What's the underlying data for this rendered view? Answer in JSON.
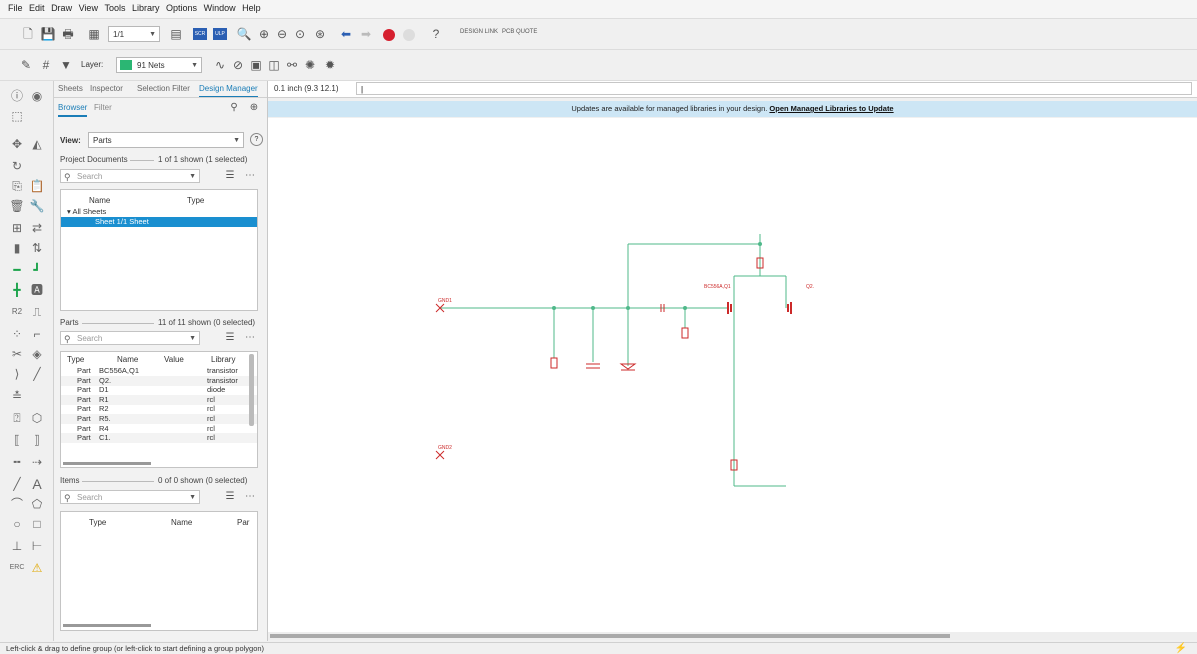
{
  "menu": [
    "File",
    "Edit",
    "Draw",
    "View",
    "Tools",
    "Library",
    "Options",
    "Window",
    "Help"
  ],
  "toolbar": {
    "page_value": "1/1",
    "layer_label": "Layer:",
    "layer_value": "91 Nets",
    "layer_color": "#2bb673",
    "design_link_label": "DESIGN LINK",
    "pcb_quote_label": "PCB QUOTE"
  },
  "panel": {
    "tabs": [
      "Sheets",
      "Inspector",
      "Selection Filter",
      "Design Manager"
    ],
    "active_tab": "Design Manager",
    "subtabs": [
      "Browser",
      "Filter"
    ],
    "view_label": "View:",
    "view_value": "Parts",
    "project_documents": {
      "title": "Project Documents",
      "count": "1 of 1 shown (1 selected)",
      "search_placeholder": "Search",
      "columns": [
        "Name",
        "Type"
      ],
      "tree_root": "All Sheets",
      "tree_item": "Sheet 1/1 Sheet"
    },
    "parts": {
      "title": "Parts",
      "count": "11 of 11 shown (0 selected)",
      "search_placeholder": "Search",
      "columns": [
        "Type",
        "Name",
        "Value",
        "Library"
      ],
      "rows": [
        {
          "type": "Part",
          "name": "BC556A,Q1",
          "library": "transistor"
        },
        {
          "type": "Part",
          "name": "Q2.",
          "library": "transistor"
        },
        {
          "type": "Part",
          "name": "D1",
          "library": "diode"
        },
        {
          "type": "Part",
          "name": "R1",
          "library": "rcl"
        },
        {
          "type": "Part",
          "name": "R2",
          "library": "rcl"
        },
        {
          "type": "Part",
          "name": "R5.",
          "library": "rcl"
        },
        {
          "type": "Part",
          "name": "R4",
          "library": "rcl"
        },
        {
          "type": "Part",
          "name": "C1.",
          "library": "rcl"
        }
      ]
    },
    "items": {
      "title": "Items",
      "count": "0 of 0 shown (0 selected)",
      "search_placeholder": "Search",
      "columns": [
        "Type",
        "Name",
        "Par"
      ]
    }
  },
  "canvas": {
    "coord_readout": "0.1 inch (9.3 12.1)",
    "command_value": "",
    "notice_text": "Updates are available for managed libraries in your design.",
    "notice_link": "Open Managed Libraries to Update",
    "labels": {
      "gnd1": "GND1",
      "gnd2": "GND2",
      "q1": "BC556A,Q1",
      "q2": "Q2."
    }
  },
  "status": {
    "text": "Left-click & drag to define group (or left-click to start defining a group polygon)"
  },
  "colors": {
    "accent": "#1a7db7",
    "selection": "#1a8fd0",
    "notice_bg": "#cde6f5",
    "wire": "#4fb88a",
    "part": "#cc2a2a"
  }
}
